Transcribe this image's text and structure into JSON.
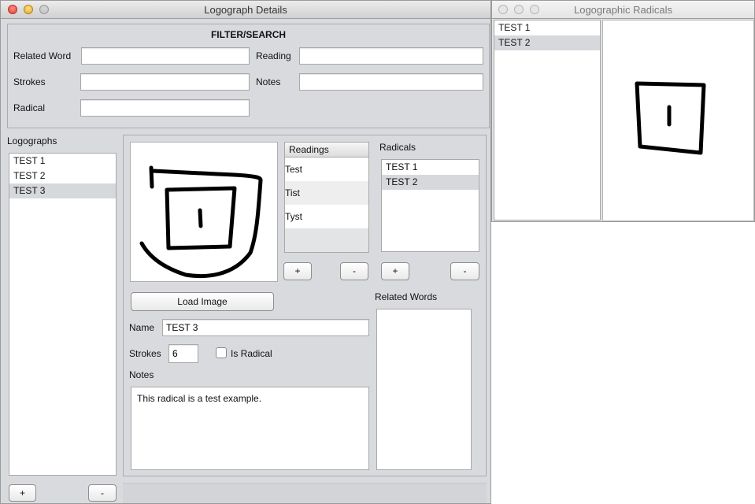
{
  "main_window": {
    "title": "Logograph Details",
    "filter": {
      "heading": "FILTER/SEARCH",
      "related_word_label": "Related Word",
      "related_word_value": "",
      "reading_label": "Reading",
      "reading_value": "",
      "strokes_label": "Strokes",
      "strokes_value": "",
      "notes_label": "Notes",
      "notes_value": "",
      "radical_label": "Radical",
      "radical_value": ""
    },
    "logographs": {
      "label": "Logographs",
      "items": [
        "TEST 1",
        "TEST 2",
        "TEST 3"
      ],
      "selected": "TEST 3",
      "add_label": "+",
      "remove_label": "-"
    },
    "detail": {
      "readings": {
        "header": "Readings",
        "items": [
          "Test",
          "Tist",
          "Tyst"
        ],
        "add_label": "+",
        "remove_label": "-"
      },
      "radicals": {
        "label": "Radicals",
        "items": [
          "TEST 1",
          "TEST 2"
        ],
        "selected": "TEST 2",
        "add_label": "+",
        "remove_label": "-"
      },
      "load_image_label": "Load Image",
      "name_label": "Name",
      "name_value": "TEST 3",
      "strokes_label": "Strokes",
      "strokes_value": "6",
      "is_radical_label": "Is Radical",
      "is_radical_checked": false,
      "notes_label": "Notes",
      "notes_value": "This radical is a test example.",
      "related_words_label": "Related Words",
      "related_words": []
    }
  },
  "radicals_window": {
    "title": "Logographic Radicals",
    "items": [
      "TEST 1",
      "TEST 2"
    ],
    "selected": "TEST 2"
  },
  "colors": {
    "window_bg": "#d8dade",
    "selection": "#d6d8dc",
    "close_button": "#e0443a",
    "minimize_button": "#e0a92a"
  }
}
